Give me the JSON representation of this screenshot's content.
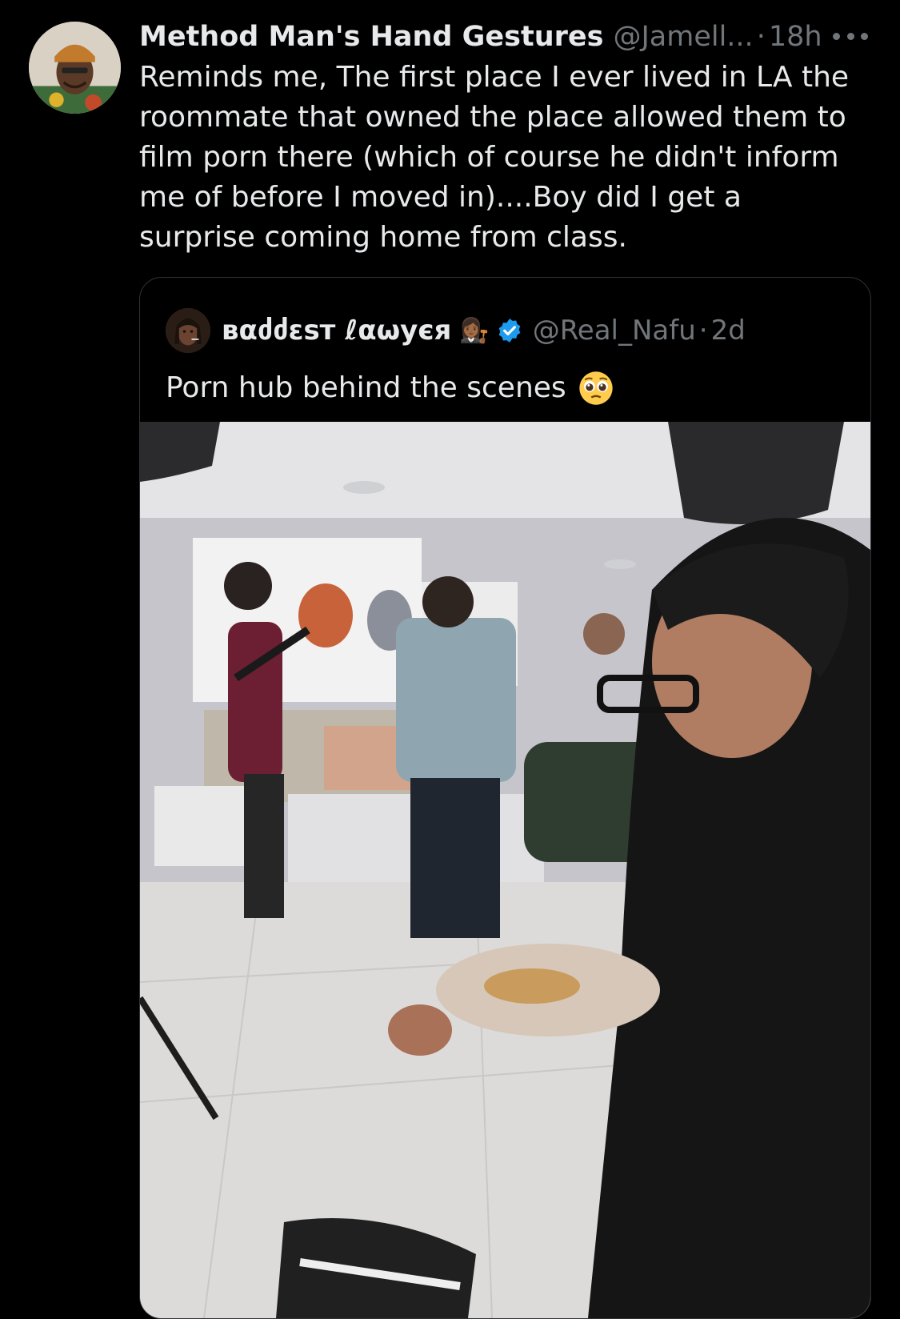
{
  "tweet": {
    "display_name": "Method Man's Hand Gestures",
    "handle": "@Jamell...",
    "separator": "·",
    "time": "18h",
    "more_icon": "more-horizontal-icon",
    "text": "Reminds me, The first place I ever lived in LA the roommate that owned the place allowed them to film porn there (which of course he didn't inform me of before I moved in)....Boy did I get a surprise coming home from class."
  },
  "quote": {
    "display_name": "ʙαძძɛsт ℓαωуєя",
    "name_emoji": "👩🏾‍⚖️",
    "verified_icon": "verified-badge-icon",
    "handle": "@Real_Nafu",
    "separator": "·",
    "time": "2d",
    "text": "Porn hub behind the scenes",
    "text_emoji_icon": "pleading-face-icon",
    "media_icon": "photo-icon"
  },
  "colors": {
    "background": "#000000",
    "text_primary": "#e7e9ea",
    "text_secondary": "#71767b",
    "border": "#2f3336",
    "verified": "#1d9bf0"
  }
}
